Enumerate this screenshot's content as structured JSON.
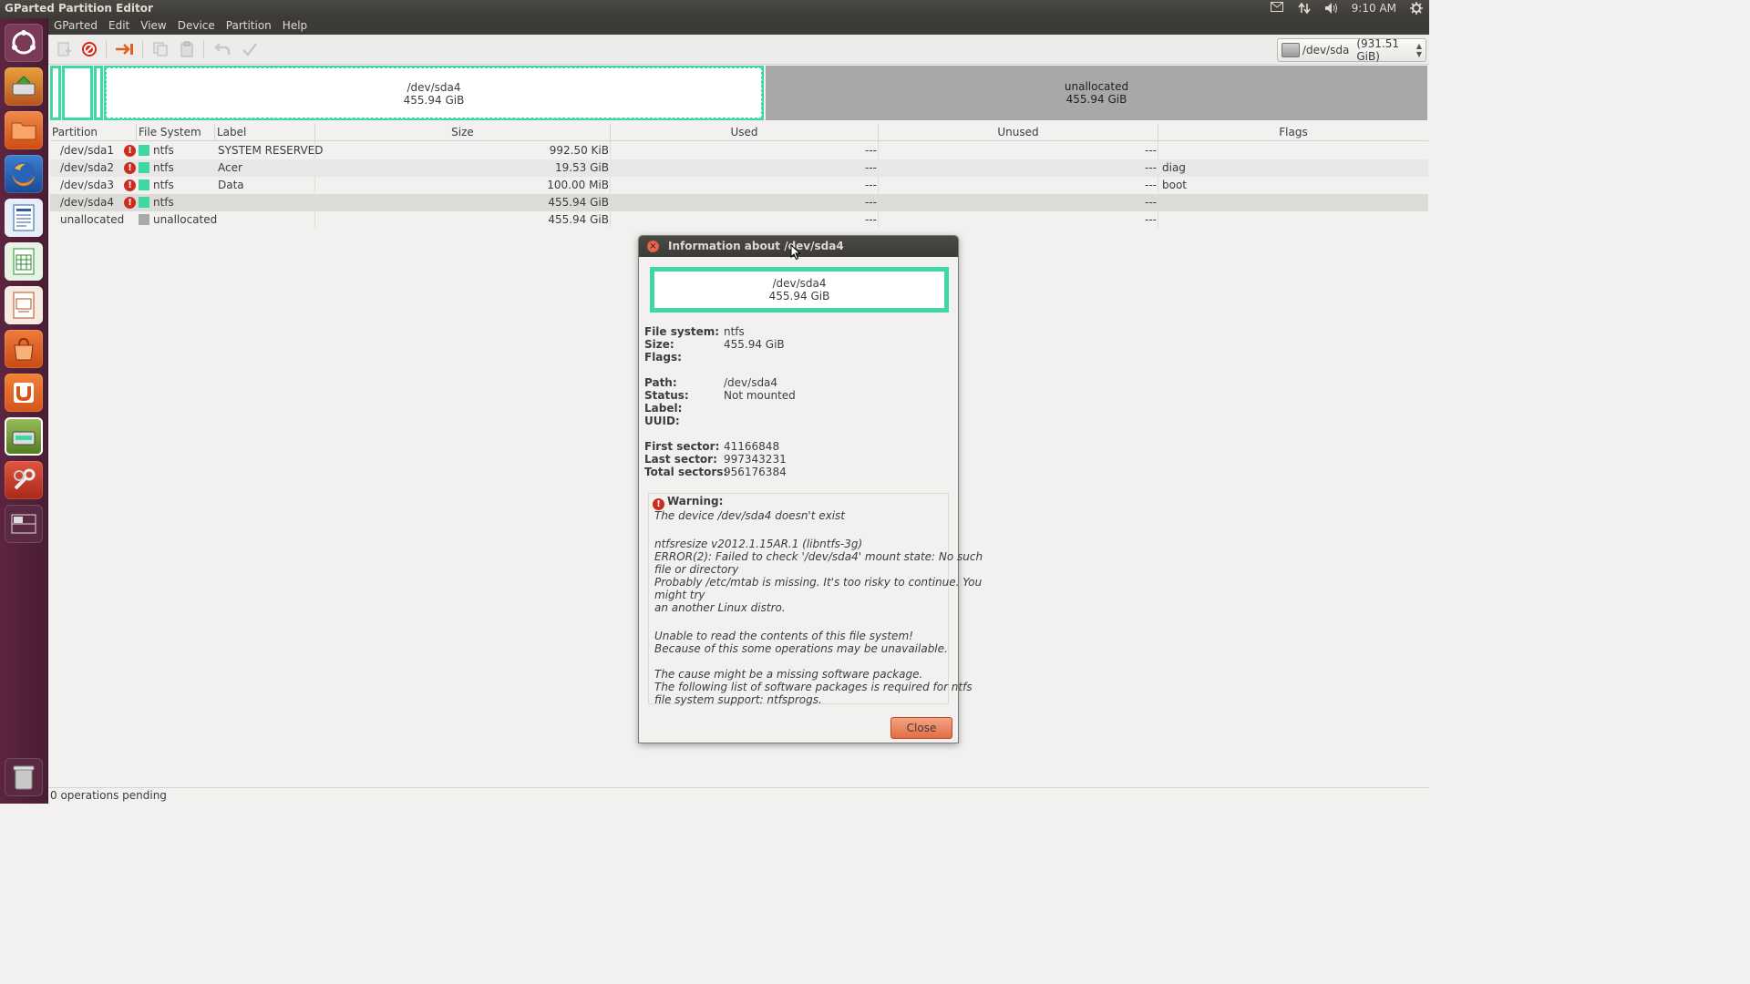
{
  "top_panel": {
    "title": "GParted Partition Editor",
    "time": "9:10 AM",
    "icons": [
      "mail-icon",
      "network-icon",
      "volume-icon",
      "settings-gear-icon"
    ]
  },
  "launcher": {
    "items": [
      "dash-home",
      "gparted",
      "files",
      "firefox",
      "libreoffice-writer",
      "libreoffice-calc",
      "libreoffice-impress",
      "software-center",
      "ubuntu-one",
      "gparted-active",
      "system-settings",
      "workspace-switcher",
      "trash"
    ]
  },
  "menubar": {
    "items": [
      "GParted",
      "Edit",
      "View",
      "Device",
      "Partition",
      "Help"
    ]
  },
  "toolbar": {
    "device_name": "/dev/sda",
    "device_size": "(931.51 GiB)"
  },
  "disk_graphic": {
    "selected_name": "/dev/sda4",
    "selected_size": "455.94 GiB",
    "unalloc_name": "unallocated",
    "unalloc_size": "455.94 GiB",
    "colors": {
      "ntfs": "#3fd8a2",
      "unallocated": "#a8a8a8"
    }
  },
  "table": {
    "headers": [
      "Partition",
      "File System",
      "Label",
      "Size",
      "Used",
      "Unused",
      "Flags"
    ],
    "rows": [
      {
        "partition": "/dev/sda1",
        "warn": true,
        "fs": "ntfs",
        "label": "SYSTEM RESERVED",
        "size": "992.50 KiB",
        "used": "---",
        "unused": "---",
        "flags": ""
      },
      {
        "partition": "/dev/sda2",
        "warn": true,
        "fs": "ntfs",
        "label": "Acer",
        "size": "19.53 GiB",
        "used": "---",
        "unused": "---",
        "flags": "diag"
      },
      {
        "partition": "/dev/sda3",
        "warn": true,
        "fs": "ntfs",
        "label": "Data",
        "size": "100.00 MiB",
        "used": "---",
        "unused": "---",
        "flags": "boot"
      },
      {
        "partition": "/dev/sda4",
        "warn": true,
        "fs": "ntfs",
        "label": "",
        "size": "455.94 GiB",
        "used": "---",
        "unused": "---",
        "flags": ""
      },
      {
        "partition": "unallocated",
        "warn": false,
        "fs": "unallocated",
        "label": "",
        "size": "455.94 GiB",
        "used": "---",
        "unused": "---",
        "flags": ""
      }
    ]
  },
  "statusbar": {
    "text": "0 operations pending"
  },
  "dialog": {
    "title": "Information about /dev/sda4",
    "graphic_name": "/dev/sda4",
    "graphic_size": "455.94 GiB",
    "fields": [
      {
        "key": "File system:",
        "value": "ntfs"
      },
      {
        "key": "Size:",
        "value": "455.94 GiB"
      },
      {
        "key": "Flags:",
        "value": ""
      },
      {
        "key": "Path:",
        "value": "/dev/sda4"
      },
      {
        "key": "Status:",
        "value": "Not mounted"
      },
      {
        "key": "Label:",
        "value": ""
      },
      {
        "key": "UUID:",
        "value": ""
      },
      {
        "key": "First sector:",
        "value": "41166848"
      },
      {
        "key": "Last sector:",
        "value": "997343231"
      },
      {
        "key": "Total sectors:",
        "value": "956176384"
      }
    ],
    "warning_title": "Warning:",
    "warning_lines": [
      "The device /dev/sda4 doesn't exist",
      "",
      "ntfsresize v2012.1.15AR.1 (libntfs-3g)",
      "ERROR(2): Failed to check '/dev/sda4' mount state: No such",
      "file or directory",
      "Probably /etc/mtab is missing. It's too risky to continue. You",
      "might try",
      "an another Linux distro.",
      "",
      "Unable to read the contents of this file system!",
      "Because of this some operations may be unavailable.",
      "",
      "The cause might be a missing software package.",
      "The following list of software packages is required for ntfs",
      "file system support:  ntfsprogs."
    ],
    "close_label": "Close"
  }
}
